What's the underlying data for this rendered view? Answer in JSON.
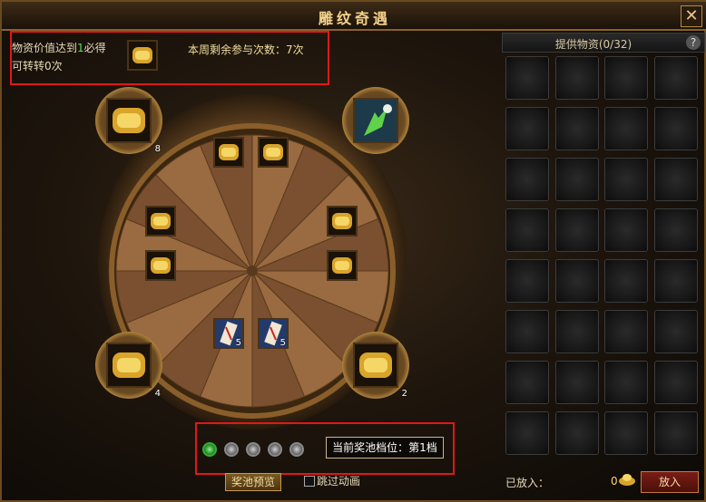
{
  "window": {
    "title": "雕纹奇遇",
    "close_label": "✕"
  },
  "info": {
    "line1_prefix": "物资价值达到",
    "line1_highlight": "1",
    "line1_suffix": "必得",
    "line2": "可转转0次",
    "remaining": "本周剩余参与次数：7次"
  },
  "corner_items": [
    {
      "id": "top-left",
      "icon": "gold-scroll-icon",
      "count": "8"
    },
    {
      "id": "top-right",
      "icon": "green-plant-icon",
      "count": ""
    },
    {
      "id": "bottom-left",
      "icon": "gold-scroll-icon",
      "count": "4"
    },
    {
      "id": "bottom-right",
      "icon": "gold-scroll-icon",
      "count": "2"
    }
  ],
  "wheel_items": [
    {
      "icon": "gold-scroll-icon",
      "count": ""
    },
    {
      "icon": "gold-scroll-icon",
      "count": ""
    },
    {
      "icon": "gold-scroll-icon",
      "count": ""
    },
    {
      "icon": "gold-scroll-icon",
      "count": ""
    },
    {
      "icon": "gold-scroll-icon",
      "count": ""
    },
    {
      "icon": "gold-scroll-icon",
      "count": ""
    },
    {
      "icon": "red-talisman-icon",
      "count": "5"
    },
    {
      "icon": "red-talisman-icon",
      "count": "5"
    }
  ],
  "tier": {
    "text": "当前奖池档位：第1档",
    "levels": 5,
    "active_index": 0
  },
  "preview_button": "奖池预览",
  "skip_animation": "跳过动画",
  "supply": {
    "header": "提供物资(0/32)",
    "help": "?",
    "placed_label": "已放入：",
    "placed_value": "0",
    "put_button": "放入"
  },
  "colors": {
    "accent_gold": "#f2d28a",
    "highlight_red": "#e01818",
    "active_green": "#2fb32f"
  }
}
